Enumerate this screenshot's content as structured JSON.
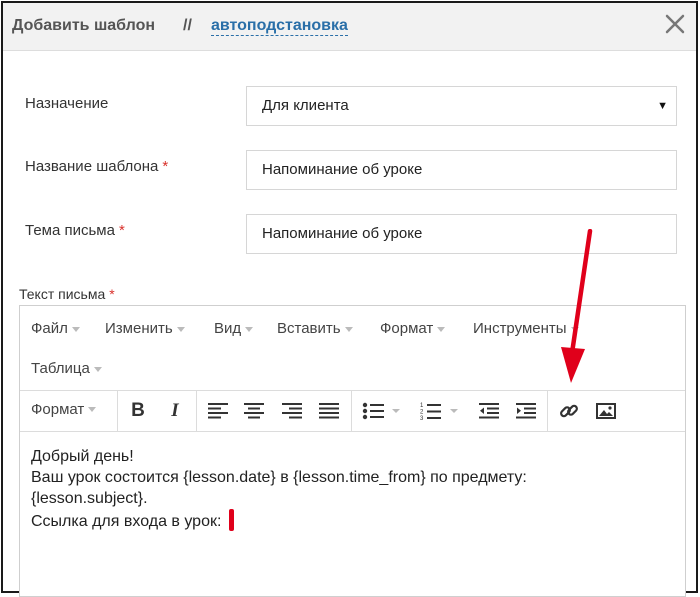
{
  "header": {
    "title": "Добавить шаблон",
    "separator": "//",
    "link": "автоподстановка"
  },
  "form": {
    "purpose": {
      "label": "Назначение",
      "value": "Для клиента"
    },
    "template_name": {
      "label": "Название шаблона",
      "required_mark": "*",
      "value": "Напоминание об уроке"
    },
    "subject": {
      "label": "Тема письма",
      "required_mark": "*",
      "value": "Напоминание об уроке"
    },
    "body_label": {
      "label": "Текст письма",
      "required_mark": "*"
    }
  },
  "editor": {
    "menu": [
      "Файл",
      "Изменить",
      "Вид",
      "Вставить",
      "Формат",
      "Инструменты",
      "Таблица"
    ],
    "format_dropdown": "Формат",
    "bold": "B",
    "italic": "I",
    "toolbar_icons": [
      "bold-icon",
      "italic-icon",
      "align-left-icon",
      "align-center-icon",
      "align-right-icon",
      "align-justify-icon",
      "bullet-list-icon",
      "numbered-list-icon",
      "outdent-icon",
      "indent-icon",
      "link-icon",
      "image-icon"
    ],
    "content": {
      "line1": "Добрый день!",
      "line2": "Ваш урок состоится {lesson.date} в {lesson.time_from} по предмету:",
      "line3": "{lesson.subject}.",
      "line4": "Ссылка для входа в урок:"
    }
  },
  "colors": {
    "link": "#2a6fa8",
    "required": "#d9312b",
    "annotation_arrow": "#e0001b"
  }
}
